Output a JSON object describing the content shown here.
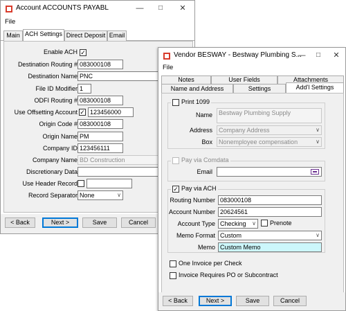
{
  "window1": {
    "title": "Account ACCOUNTS PAYABL",
    "menu_file": "File",
    "tabs": [
      "Main",
      "ACH Settings",
      "Direct Deposit",
      "Email"
    ],
    "fields": {
      "enable_ach": "Enable ACH",
      "destination_routing_label": "Destination Routing #",
      "destination_routing_value": "083000108",
      "destination_name_label": "Destination Name",
      "destination_name_value": "PNC",
      "file_id_modifier_label": "File ID Modifier",
      "file_id_modifier_value": "1",
      "odfi_routing_label": "ODFI Routing #",
      "odfi_routing_value": "083000108",
      "use_offsetting_label": "Use Offsetting Account",
      "use_offsetting_value": "123456000",
      "origin_code_label": "Origin Code #",
      "origin_code_value": "083000108",
      "origin_name_label": "Origin Name",
      "origin_name_value": "PM",
      "company_id_label": "Company ID",
      "company_id_value": "123456111",
      "company_name_label": "Company Name",
      "company_name_value": "BD Construction",
      "discretionary_label": "Discretionary Data",
      "discretionary_value": "",
      "use_header_label": "Use Header Record",
      "use_header_value": "",
      "record_separator_label": "Record Separator",
      "record_separator_value": "None"
    },
    "buttons": {
      "back": "< Back",
      "next": "Next >",
      "save": "Save",
      "cancel": "Cancel"
    }
  },
  "window2": {
    "title": "Vendor BESWAY - Bestway Plumbing S...",
    "menu_file": "File",
    "tabs_row1": [
      "Notes",
      "User Fields",
      "Attachments"
    ],
    "tabs_row2": [
      "Name and Address",
      "Settings",
      "Add'l Settings"
    ],
    "print1099": {
      "label": "Print 1099",
      "name_label": "Name",
      "name_value": "Bestway Plumbing Supply",
      "address_label": "Address",
      "address_value": "Company Address",
      "box_label": "Box",
      "box_value": "Nonemployee compensation"
    },
    "comdata": {
      "label": "Pay via Comdata",
      "email_label": "Email",
      "email_value": ""
    },
    "ach": {
      "label": "Pay via ACH",
      "routing_label": "Routing Number",
      "routing_value": "083000108",
      "account_label": "Account Number",
      "account_value": "20624561",
      "account_type_label": "Account Type",
      "account_type_value": "Checking",
      "prenote_label": "Prenote",
      "memo_format_label": "Memo Format",
      "memo_format_value": "Custom",
      "memo_label": "Memo",
      "memo_value": "Custom Memo"
    },
    "one_invoice_label": "One Invoice per Check",
    "invoice_requires_label": "Invoice Requires PO or Subcontract",
    "buttons": {
      "back": "< Back",
      "next": "Next >",
      "save": "Save",
      "cancel": "Cancel"
    }
  },
  "colors": {
    "accent_blue": "#0078d7",
    "memo_highlight": "#ccf7fb",
    "panel_bg": "#f0f0f0"
  }
}
